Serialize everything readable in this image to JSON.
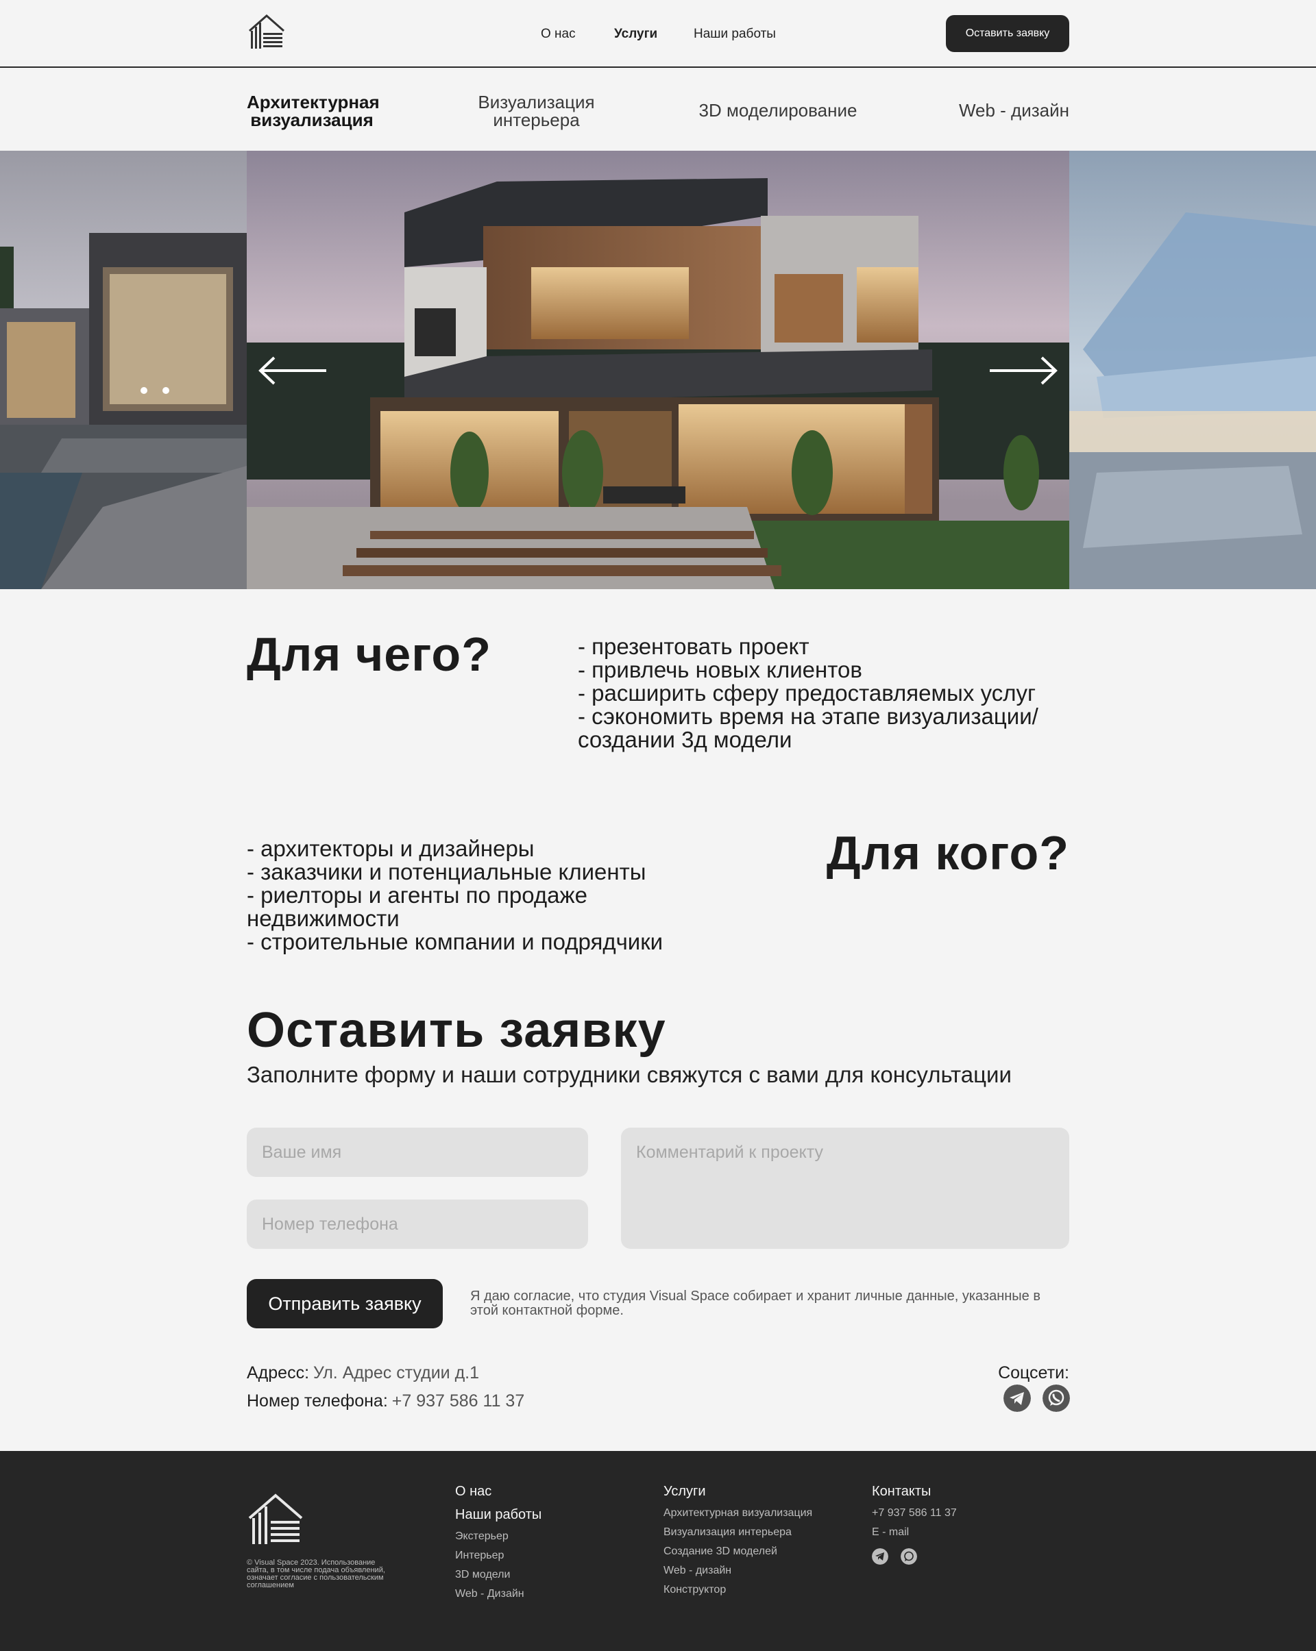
{
  "header": {
    "nav": [
      "О нас",
      "Услуги",
      "Наши работы"
    ],
    "cta": "Оставить заявку"
  },
  "tabs": [
    "Архитектурная визуализация",
    "Визуализация интерьера",
    "3D моделирование",
    "Web - дизайн"
  ],
  "why": {
    "title": "Для чего?",
    "items": [
      "- презентовать проект",
      "- привлечь новых клиентов",
      "- расширить сферу предоставляемых услуг",
      "- сэкономить время на этапе визуализации/ создании 3д модели"
    ]
  },
  "whom": {
    "title": "Для кого?",
    "items": [
      "- архитекторы и дизайнеры",
      "- заказчики и потенциальные клиенты",
      "- риелторы и агенты по продаже недвижимости",
      "- строительные компании и подрядчики"
    ]
  },
  "form": {
    "title": "Оставить заявку",
    "subtitle": "Заполните форму и наши сотрудники свяжутся с вами для консультации",
    "name_placeholder": "Ваше имя",
    "phone_placeholder": "Номер телефона",
    "comment_placeholder": "Комментарий к проекту",
    "submit": "Отправить заявку",
    "consent": "Я даю согласие, что студия Visual Space собирает и хранит личные данные, указанные в этой контактной форме."
  },
  "contacts": {
    "address_label": "Адресс:",
    "address_value": "Ул. Адрес студии д.1",
    "phone_label": "Номер телефона:",
    "phone_value": "+7 937 586 11 37",
    "social_label": "Соцсети:",
    "social_icons": [
      "telegram-icon",
      "whatsapp-icon"
    ]
  },
  "footer": {
    "copyright": "© Visual Space 2023. Использование сайта, в том числе подача объявлений, означает согласие с пользовательским соглашением",
    "col1": {
      "about": "О нас",
      "works": "Наши работы",
      "items": [
        "Экстерьер",
        "Интерьер",
        "3D модели",
        "Web - Дизайн"
      ]
    },
    "col2": {
      "title": "Услуги",
      "items": [
        "Архитектурная визуализация",
        "Визуализация интерьера",
        "Создание 3D моделей",
        "Web - дизайн",
        "Конструктор"
      ]
    },
    "col3": {
      "title": "Контакты",
      "phone": "+7 937 586 11 37",
      "email": "E - mail"
    }
  },
  "colors": {
    "background": "#f4f4f4",
    "dark": "#222222",
    "footer": "#262626",
    "input": "#e1e1e1"
  }
}
